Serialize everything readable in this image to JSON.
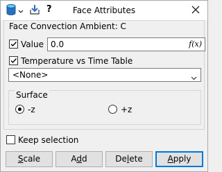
{
  "window": {
    "title": "Face Attributes",
    "icons": [
      "cylinder-icon",
      "chevron-down-icon",
      "download-icon",
      "help-icon",
      "close-icon"
    ],
    "help_label": "?"
  },
  "group": {
    "legend": "Face Convection Ambient: C",
    "value_checkbox": {
      "label": "Value",
      "checked": true
    },
    "value_input": {
      "value": "0.0",
      "fx_label": "f(x)"
    },
    "table_checkbox": {
      "label": "Temperature vs Time Table",
      "checked": true
    },
    "table_select": {
      "selected": "<None>"
    },
    "surface": {
      "legend": "Surface",
      "options": [
        {
          "label": "-z",
          "selected": true
        },
        {
          "label": "+z",
          "selected": false
        }
      ]
    }
  },
  "keep_selection": {
    "label": "Keep selection",
    "checked": false
  },
  "buttons": {
    "scale": {
      "mnemonic": "S",
      "rest": "cale"
    },
    "add": {
      "pre": "A",
      "mnemonic": "d",
      "rest": "d"
    },
    "delete": {
      "pre": "De",
      "mnemonic": "l",
      "rest": "ete"
    },
    "apply": {
      "mnemonic": "A",
      "rest": "pply"
    }
  },
  "colors": {
    "accent": "#0078d7",
    "icon_blue": "#2c6fc0",
    "icon_cyan": "#29b0d8"
  }
}
